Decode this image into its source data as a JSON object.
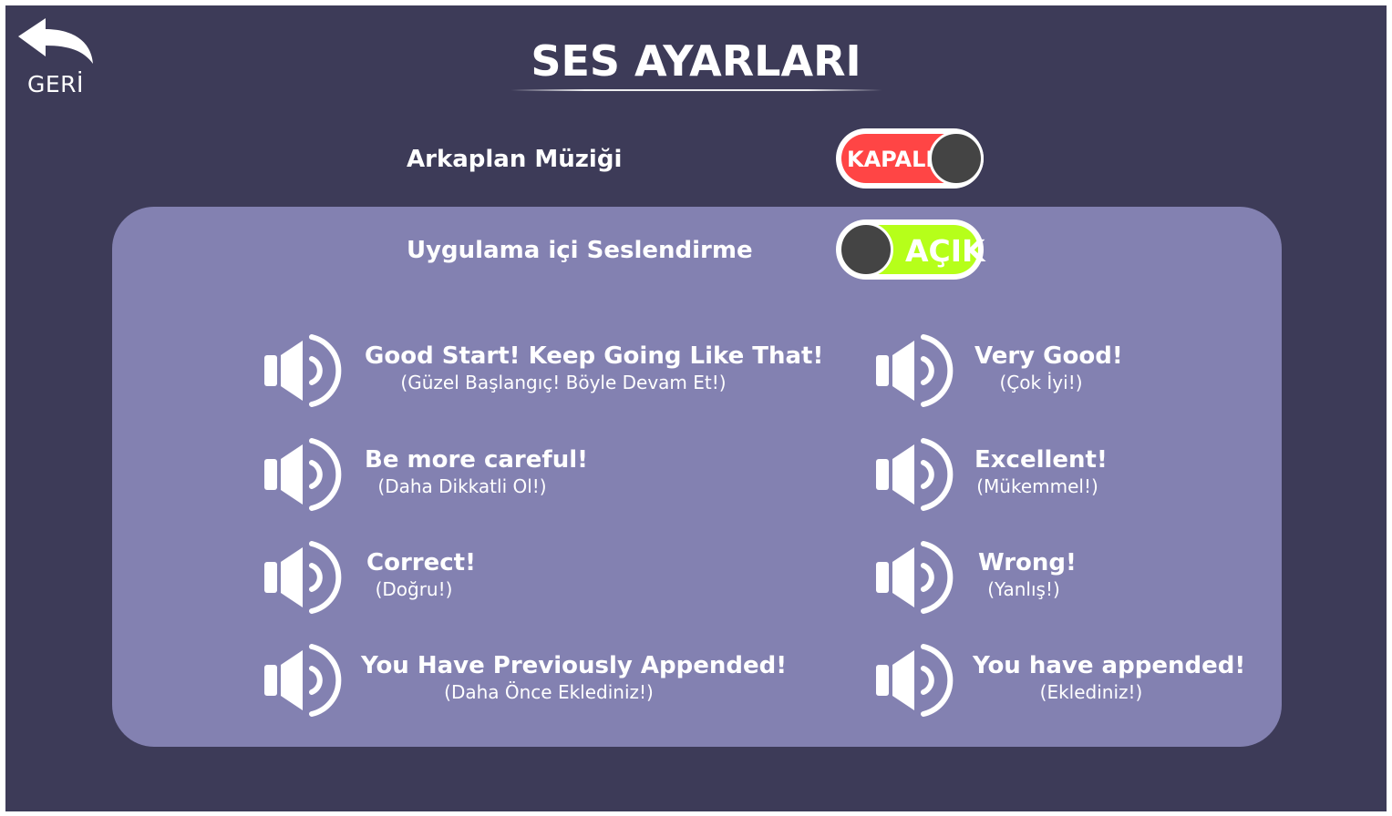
{
  "header": {
    "back_label": "GERİ",
    "title": "SES AYARLARI"
  },
  "settings": {
    "background_music": {
      "label": "Arkaplan Müziği",
      "state_label": "KAPALI",
      "enabled": false
    },
    "in_app_voice": {
      "label": "Uygulama içi Seslendirme",
      "state_label": "AÇIK",
      "enabled": true
    }
  },
  "sounds": {
    "left": [
      {
        "en": "Good Start! Keep Going Like That!",
        "tr": "(Güzel Başlangıç! Böyle Devam Et!)"
      },
      {
        "en": "Be more careful!",
        "tr": "(Daha Dikkatli Ol!)"
      },
      {
        "en": "Correct!",
        "tr": "(Doğru!)"
      },
      {
        "en": "You Have Previously Appended!",
        "tr": "(Daha Önce Eklediniz!)"
      }
    ],
    "right": [
      {
        "en": "Very Good!",
        "tr": "(Çok İyi!)"
      },
      {
        "en": "Excellent!",
        "tr": "(Mükemmel!)"
      },
      {
        "en": "Wrong!",
        "tr": "(Yanlış!)"
      },
      {
        "en": "You have appended!",
        "tr": "(Eklediniz!)"
      }
    ]
  },
  "colors": {
    "background": "#3d3b58",
    "panel": "#8381b1",
    "toggle_off": "#ff4545",
    "toggle_on": "#b6ff1a",
    "knob": "#444444"
  },
  "icons": {
    "back": "back-arrow-icon",
    "sound": "speaker-icon"
  }
}
